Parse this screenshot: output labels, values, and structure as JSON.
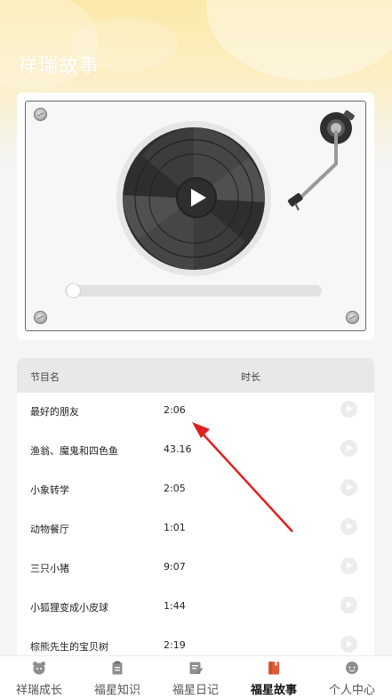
{
  "header": {
    "title": "祥瑞故事"
  },
  "player": {
    "progress": 0
  },
  "list": {
    "columns": {
      "name": "节目名",
      "duration": "时长"
    },
    "items": [
      {
        "name": "最好的朋友",
        "duration": "2:06"
      },
      {
        "name": "渔翁、魔鬼和四色鱼",
        "duration": "43.16"
      },
      {
        "name": "小象转学",
        "duration": "2:05"
      },
      {
        "name": "动物餐厅",
        "duration": "1:01"
      },
      {
        "name": "三只小猪",
        "duration": "9:07"
      },
      {
        "name": "小狐狸变成小皮球",
        "duration": "1:44"
      },
      {
        "name": "棕熊先生的宝贝树",
        "duration": "2:19"
      }
    ]
  },
  "tabbar": {
    "tabs": [
      {
        "label": "祥瑞成长",
        "icon": "mascot-face-icon"
      },
      {
        "label": "福星知识",
        "icon": "clipboard-icon"
      },
      {
        "label": "福星日记",
        "icon": "notepad-edit-icon"
      },
      {
        "label": "福星故事",
        "icon": "book-icon",
        "active": true
      },
      {
        "label": "个人中心",
        "icon": "user-face-icon"
      }
    ]
  },
  "colors": {
    "accent": "#e05a3a",
    "annotation_arrow": "#e02020"
  }
}
